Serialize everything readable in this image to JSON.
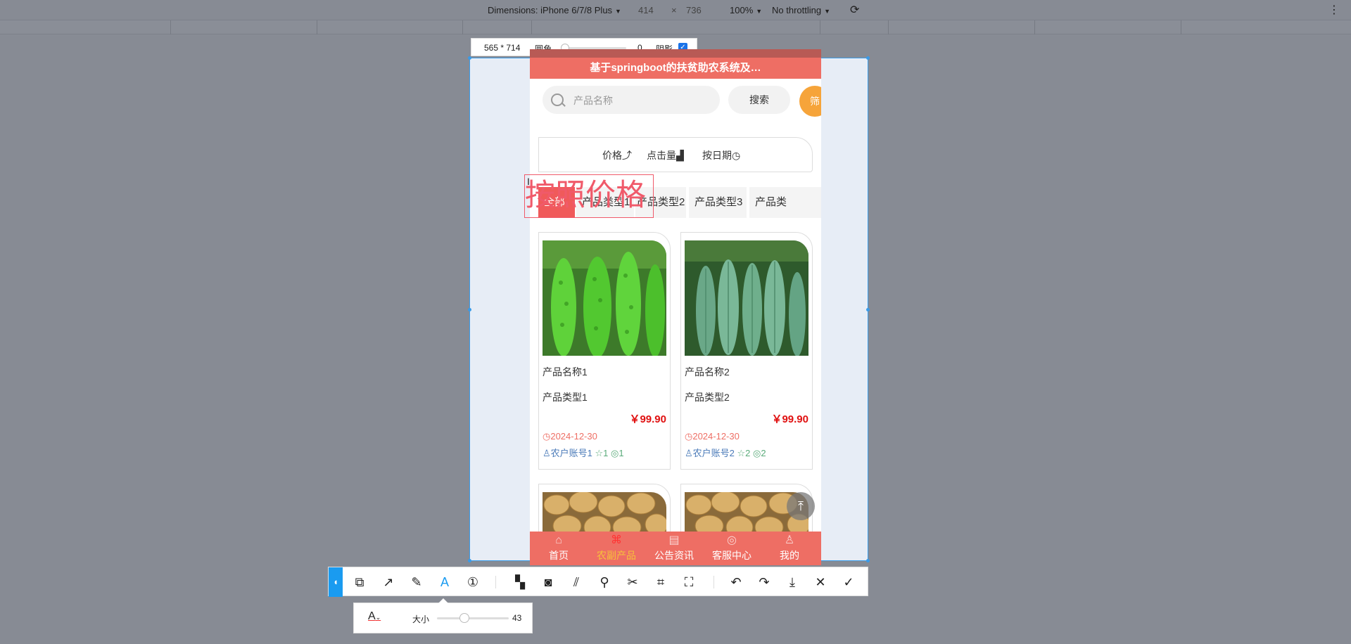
{
  "devtools": {
    "dimensions_label": "Dimensions: iPhone 6/7/8 Plus",
    "width": "414",
    "times": "×",
    "height": "736",
    "zoom": "100%",
    "throttling": "No throttling",
    "menu": "⋮"
  },
  "selection": {
    "size": "565 * 714",
    "corner_label": "圆角",
    "corner_value": "0",
    "shadow_label": "阴影",
    "shadow_checked": true
  },
  "app": {
    "title": "基于springboot的扶贫助农系统及…",
    "search_placeholder": "产品名称",
    "search_button": "搜索",
    "filter_button": "筛",
    "sort": [
      "价格",
      "点击量",
      "按日期"
    ],
    "categories": [
      "全部",
      "产品类型1",
      "产品类型2",
      "产品类型3",
      "产品类"
    ],
    "products": [
      {
        "name": "产品名称1",
        "type": "产品类型1",
        "price": "￥99.90",
        "date": "2024-12-30",
        "account": "农户账号1",
        "stars": "1",
        "views": "1"
      },
      {
        "name": "产品名称2",
        "type": "产品类型2",
        "price": "￥99.90",
        "date": "2024-12-30",
        "account": "农户账号2",
        "stars": "2",
        "views": "2"
      }
    ],
    "tabs": [
      "首页",
      "农副产品",
      "公告资讯",
      "客服中心",
      "我的"
    ]
  },
  "annotation": {
    "text": "按照价格"
  },
  "text_panel": {
    "size_label": "大小",
    "size_value": "43"
  }
}
